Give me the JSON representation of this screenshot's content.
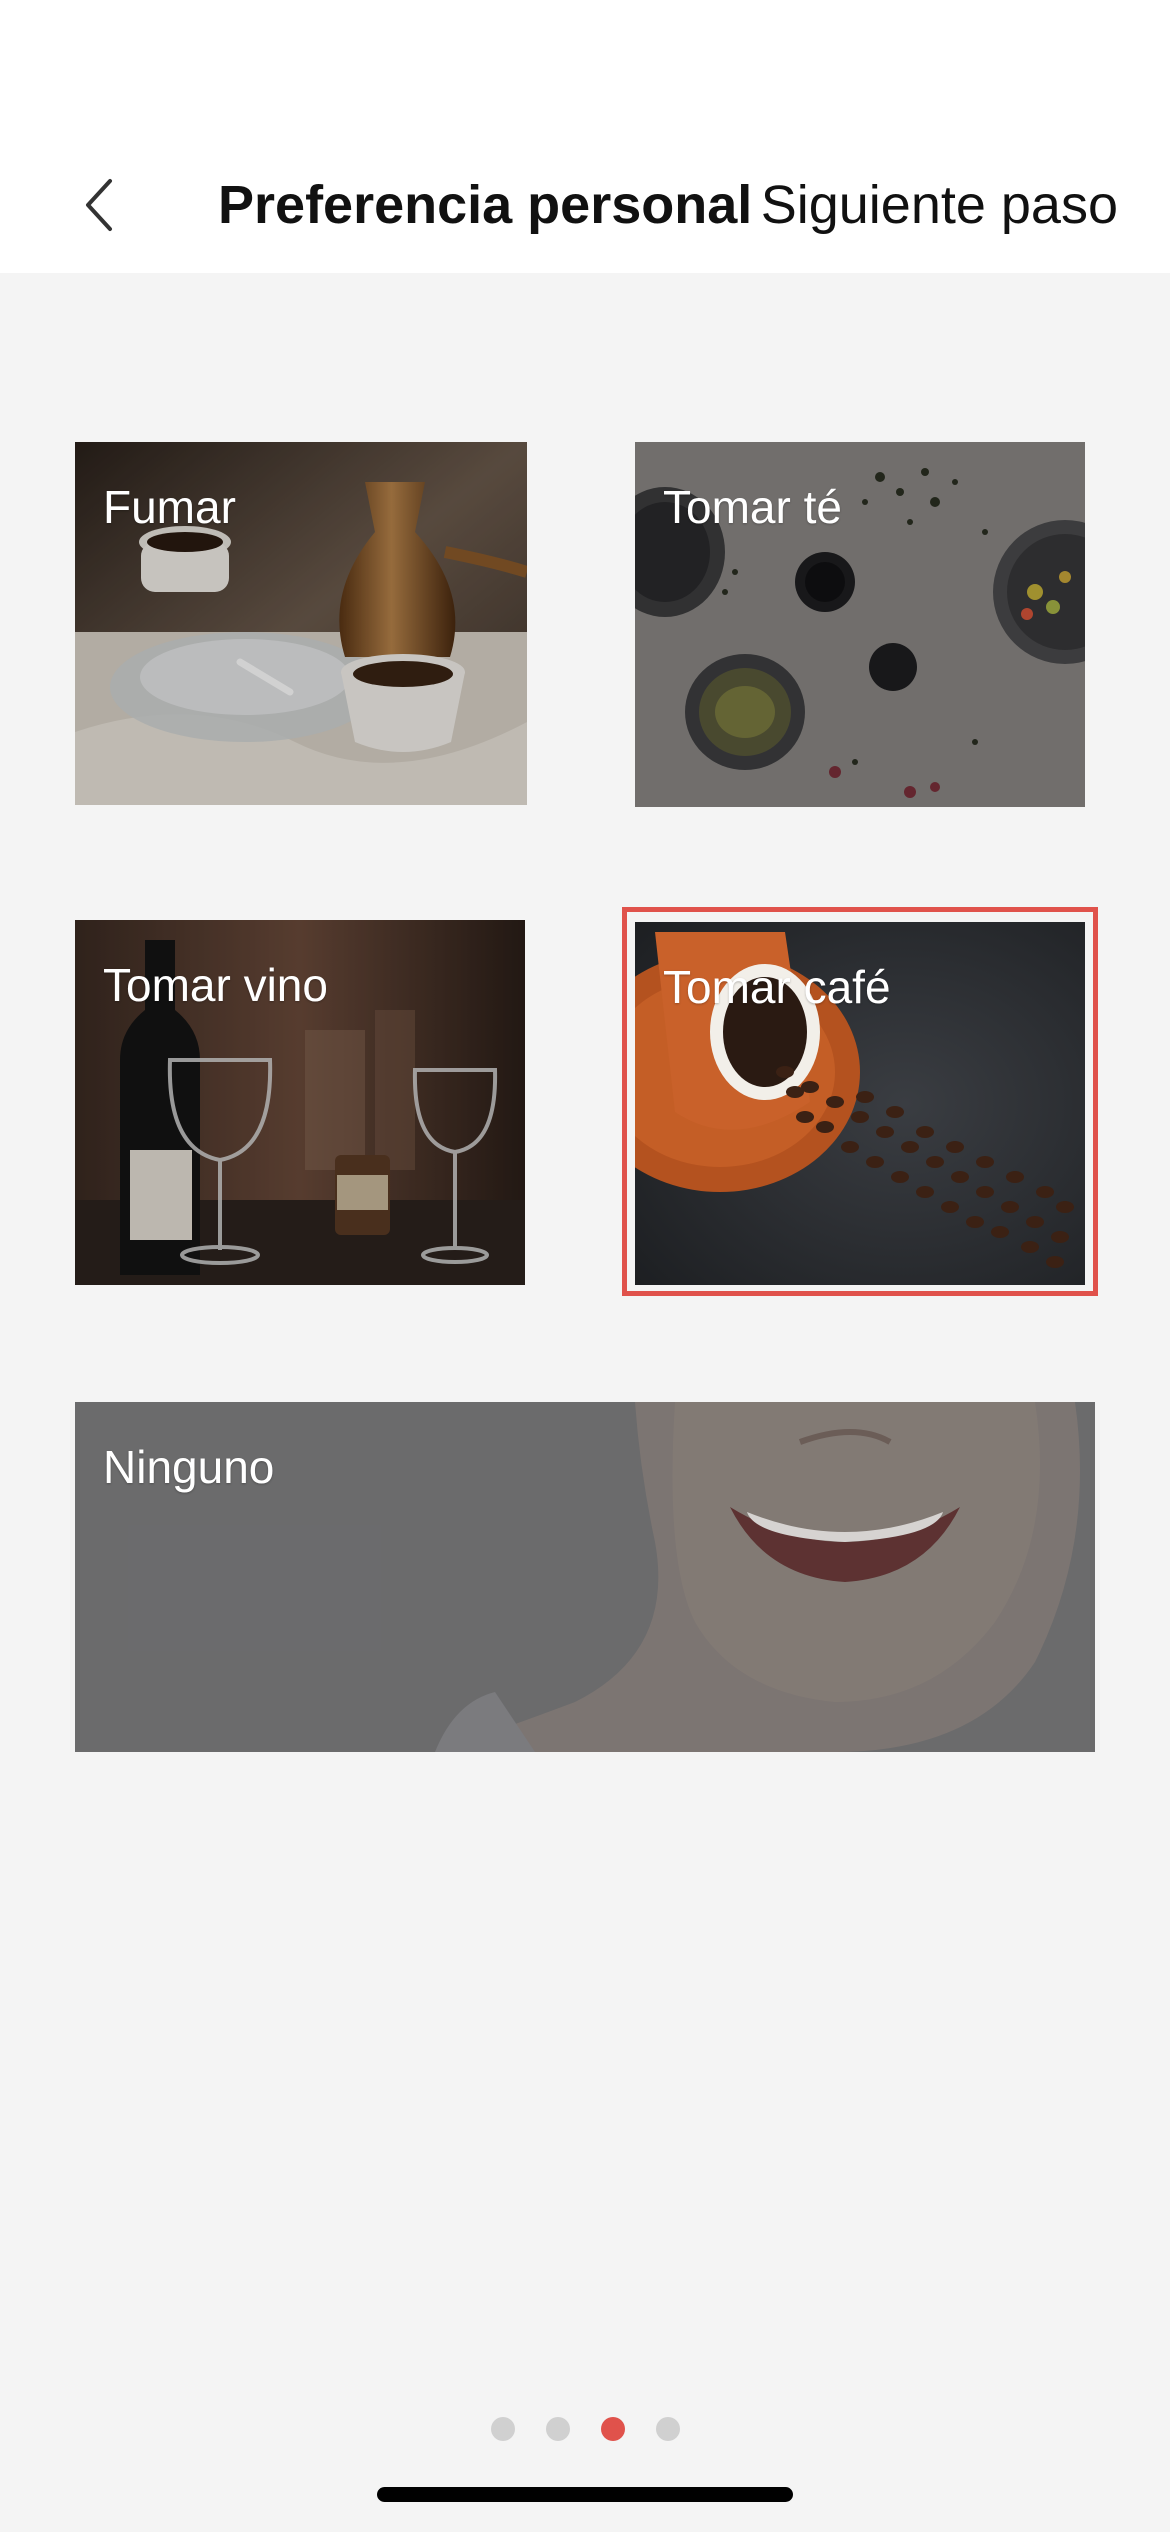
{
  "header": {
    "title": "Preferencia personal",
    "next_label": "Siguiente paso",
    "back_icon": "chevron-left-icon"
  },
  "options": [
    {
      "label": "Fumar",
      "selected": false,
      "image": "ashtray-and-coffee-pot-photo"
    },
    {
      "label": "Tomar té",
      "selected": false,
      "image": "tea-cups-on-linen-photo"
    },
    {
      "label": "Tomar vino",
      "selected": false,
      "image": "wine-glasses-photo"
    },
    {
      "label": "Tomar café",
      "selected": true,
      "image": "spilled-coffee-beans-photo"
    },
    {
      "label": "Ninguno",
      "selected": false,
      "image": "smiling-woman-photo"
    }
  ],
  "pager": {
    "total_pages": 4,
    "current_page": 3
  },
  "colors": {
    "accent": "#e0524b",
    "background": "#f4f4f4",
    "header_bg": "#ffffff"
  }
}
